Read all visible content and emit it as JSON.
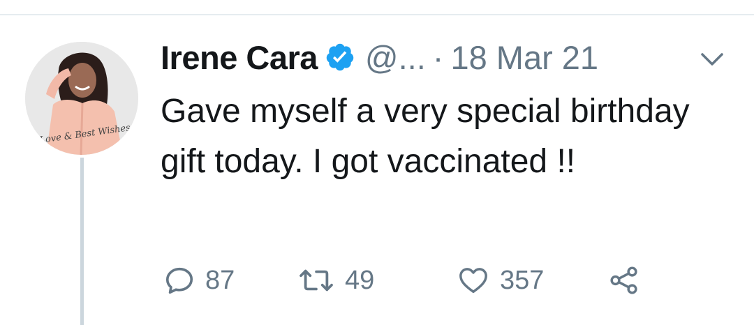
{
  "tweet": {
    "author_name": "Irene Cara",
    "handle": "@...",
    "separator": "·",
    "date": "18 Mar 21",
    "text": "Gave myself a very special birthday gift today. I got vaccinated !!",
    "verified": true
  },
  "avatar": {
    "signature": "Love & Best Wishes"
  },
  "actions": {
    "replies": "87",
    "retweets": "49",
    "likes": "357"
  },
  "icons": {
    "verified": "verified-badge-icon",
    "menu": "chevron-down-icon",
    "reply": "reply-icon",
    "retweet": "retweet-icon",
    "like": "heart-icon",
    "share": "share-icon"
  },
  "colors": {
    "verified_blue": "#1da1f2",
    "secondary_text": "#657786",
    "primary_text": "#14171a",
    "divider": "#e6ecf0",
    "thread_line": "#ccd6dd"
  }
}
